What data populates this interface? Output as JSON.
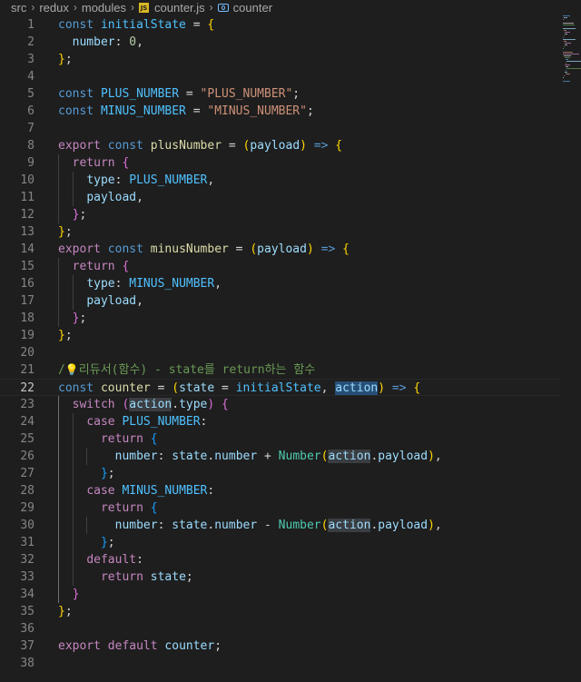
{
  "breadcrumb": {
    "items": [
      "src",
      "redux",
      "modules",
      "counter.js",
      "counter"
    ],
    "file_icon_label": "JS"
  },
  "editor": {
    "current_line": 22,
    "lines": [
      {
        "n": "1",
        "code": "const initialState = {"
      },
      {
        "n": "2",
        "code": "  number: 0,"
      },
      {
        "n": "3",
        "code": "};"
      },
      {
        "n": "4",
        "code": ""
      },
      {
        "n": "5",
        "code": "const PLUS_NUMBER = \"PLUS_NUMBER\";"
      },
      {
        "n": "6",
        "code": "const MINUS_NUMBER = \"MINUS_NUMBER\";"
      },
      {
        "n": "7",
        "code": ""
      },
      {
        "n": "8",
        "code": "export const plusNumber = (payload) => {"
      },
      {
        "n": "9",
        "code": "  return {"
      },
      {
        "n": "10",
        "code": "    type: PLUS_NUMBER,"
      },
      {
        "n": "11",
        "code": "    payload,"
      },
      {
        "n": "12",
        "code": "  };"
      },
      {
        "n": "13",
        "code": "};"
      },
      {
        "n": "14",
        "code": "export const minusNumber = (payload) => {"
      },
      {
        "n": "15",
        "code": "  return {"
      },
      {
        "n": "16",
        "code": "    type: MINUS_NUMBER,"
      },
      {
        "n": "17",
        "code": "    payload,"
      },
      {
        "n": "18",
        "code": "  };"
      },
      {
        "n": "19",
        "code": "};"
      },
      {
        "n": "20",
        "code": ""
      },
      {
        "n": "21",
        "code": "//리듀서(함수) - state를 return하는 함수"
      },
      {
        "n": "22",
        "code": "const counter = (state = initialState, action) => {"
      },
      {
        "n": "23",
        "code": "  switch (action.type) {"
      },
      {
        "n": "24",
        "code": "    case PLUS_NUMBER:"
      },
      {
        "n": "25",
        "code": "      return {"
      },
      {
        "n": "26",
        "code": "        number: state.number + Number(action.payload),"
      },
      {
        "n": "27",
        "code": "      };"
      },
      {
        "n": "28",
        "code": "    case MINUS_NUMBER:"
      },
      {
        "n": "29",
        "code": "      return {"
      },
      {
        "n": "30",
        "code": "        number: state.number - Number(action.payload),"
      },
      {
        "n": "31",
        "code": "      };"
      },
      {
        "n": "32",
        "code": "    default:"
      },
      {
        "n": "33",
        "code": "      return state;"
      },
      {
        "n": "34",
        "code": "  }"
      },
      {
        "n": "35",
        "code": "};"
      },
      {
        "n": "36",
        "code": ""
      },
      {
        "n": "37",
        "code": "export default counter;"
      },
      {
        "n": "38",
        "code": ""
      }
    ]
  },
  "colors": {
    "background": "#1e1e1e",
    "keyword": "#569cd6",
    "control_keyword": "#c586c0",
    "string": "#ce9178",
    "number": "#b5cea8",
    "variable": "#9cdcfe",
    "constant": "#4fc1ff",
    "function": "#dcdcaa",
    "comment": "#6a9955",
    "selection": "#264f78"
  },
  "icons": {
    "file_icon": "javascript-file-icon",
    "symbol_icon": "symbol-variable-icon",
    "lightbulb": "lightbulb-icon"
  }
}
